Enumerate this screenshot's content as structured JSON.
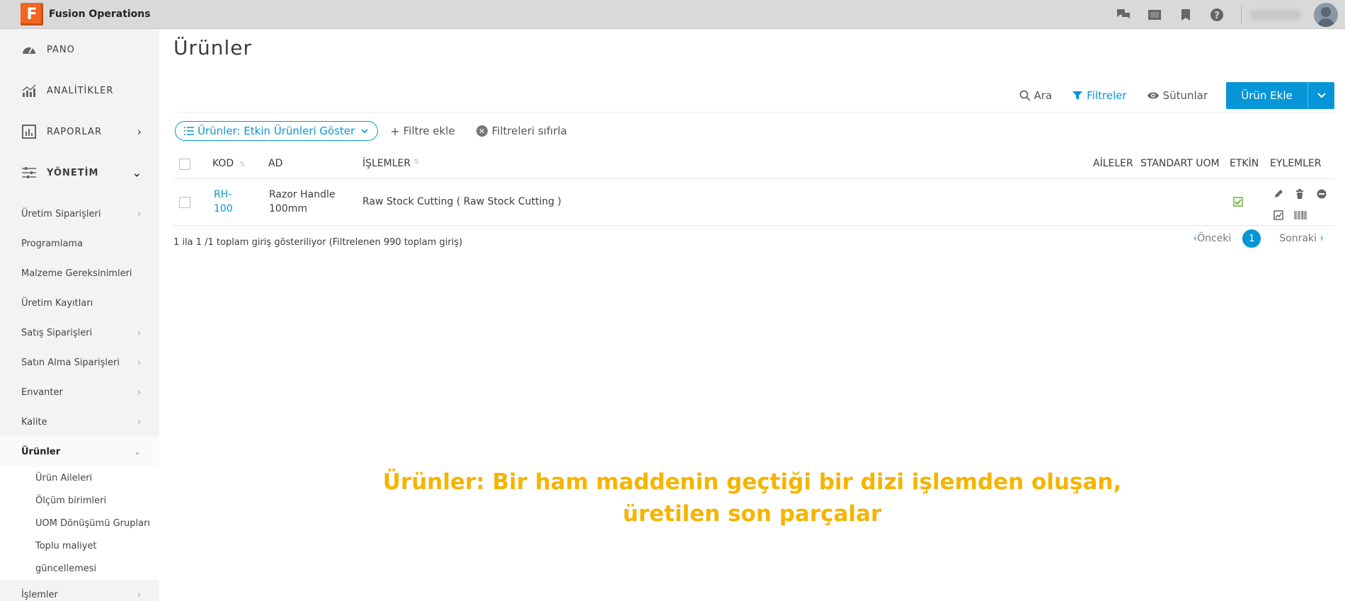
{
  "app": {
    "logo_letter": "F",
    "title": "Fusion Operations"
  },
  "topbar": {
    "icons": [
      "chat-icon",
      "screen-icon",
      "bookmark-icon",
      "help-icon"
    ]
  },
  "sidebar": {
    "main": [
      {
        "label": "PANO",
        "icon": "dashboard-icon"
      },
      {
        "label": "ANALİTİKLER",
        "icon": "analytics-icon"
      },
      {
        "label": "RAPORLAR",
        "icon": "reports-icon"
      },
      {
        "label": "YÖNETİM",
        "icon": "management-icon"
      }
    ],
    "sub": [
      "Üretim Siparişleri",
      "Programlama",
      "Malzeme Gereksinimleri",
      "Üretim Kayıtları",
      "Satış Siparişleri",
      "Satın Alma Siparişleri",
      "Envanter",
      "Kalite",
      "Ürünler"
    ],
    "products_sub": [
      "Ürün Aileleri",
      "Ölçüm birimleri",
      "UOM Dönüşümü Grupları",
      "Toplu maliyet",
      "güncellemesi"
    ],
    "last": "İşlemler"
  },
  "page": {
    "title": "Ürünler"
  },
  "toolbar": {
    "search": "Ara",
    "filters": "Filtreler",
    "columns": "Sütunlar",
    "add": "Ürün Ekle"
  },
  "filterbar": {
    "chip": "Ürünler: Etkin Ürünleri Göster",
    "add_filter": "Filtre ekle",
    "reset": "Filtreleri sıfırla"
  },
  "table": {
    "headers": {
      "code": "KOD",
      "name": "AD",
      "ops": "İŞLEMLER",
      "families": "AİLELER",
      "uom": "STANDART UOM",
      "active": "ETKİN",
      "actions": "EYLEMLER"
    },
    "rows": [
      {
        "code_1": "RH-",
        "code_2": "100",
        "name_1": "Razor Handle",
        "name_2": "100mm",
        "ops": "Raw Stock Cutting ( Raw Stock Cutting )",
        "active": true
      }
    ]
  },
  "footer": {
    "info": "1 ila 1 /1 toplam giriş gösteriliyor (Filtrelenen 990 toplam giriş)",
    "prev": "Önceki",
    "page": "1",
    "next": "Sonraki"
  },
  "caption": {
    "line1": "Ürünler: Bir ham maddenin geçtiği bir dizi işlemden oluşan,",
    "line2": "üretilen son parçalar"
  },
  "colors": {
    "accent": "#0696d7",
    "caption": "#f5b400",
    "logo": "#f26522"
  }
}
